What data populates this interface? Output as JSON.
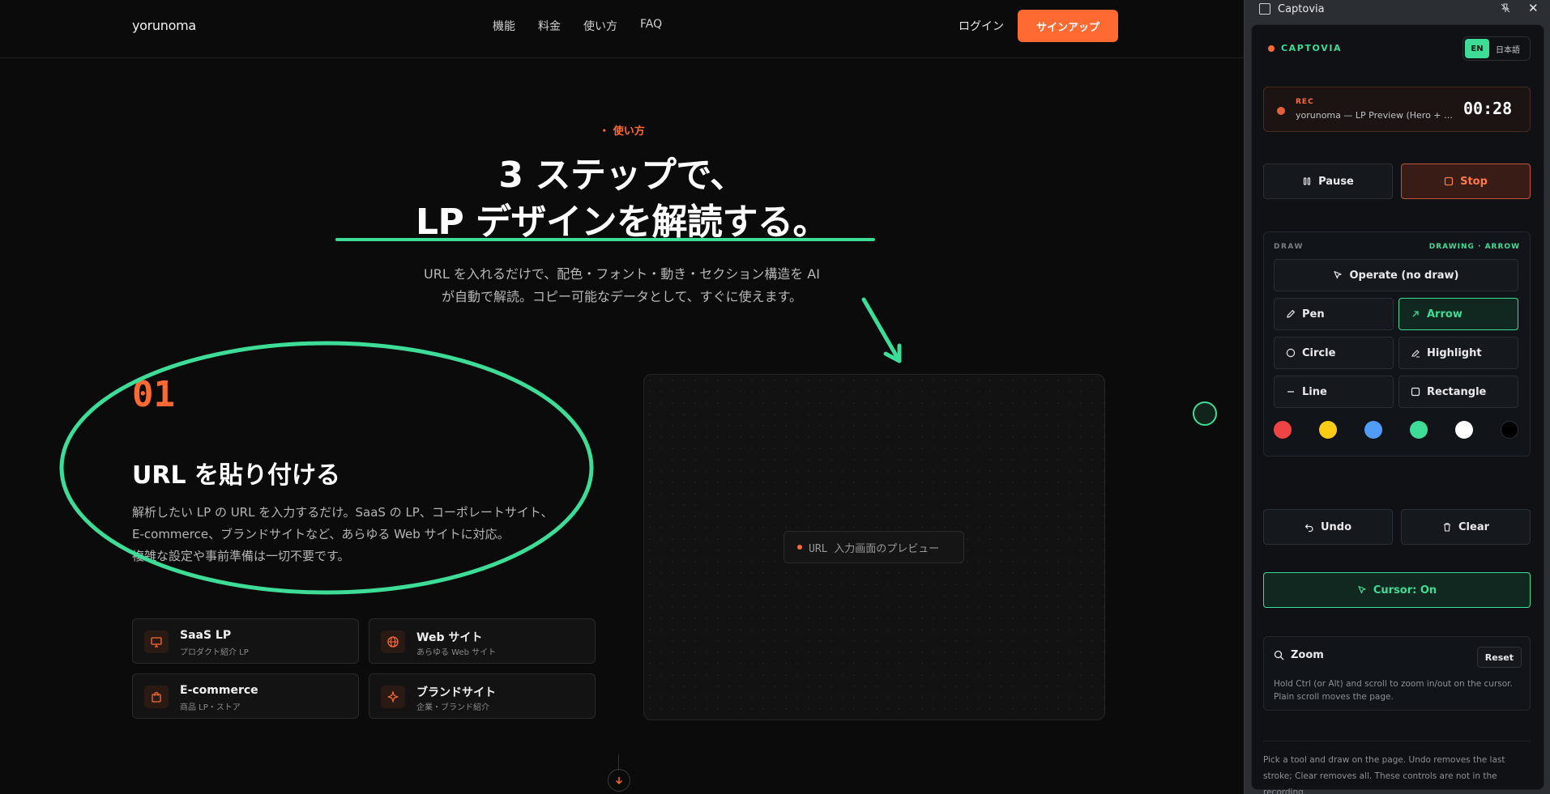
{
  "site": {
    "logo": "yorunoma",
    "nav": [
      "機能",
      "料金",
      "使い方",
      "FAQ"
    ],
    "login": "ログイン",
    "signup": "サインアップ"
  },
  "hero": {
    "eyebrow": "・ 使い方",
    "title_line1": "3 ステップで、",
    "title_line2": "LP デザインを解読する。",
    "sub_line1": "URL を入れるだけで、配色・フォント・動き・セクション構造を AI",
    "sub_line2": "が自動で解読。コピー可能なデータとして、すぐに使えます。"
  },
  "step": {
    "number": "01",
    "title": "URL を貼り付ける",
    "desc_line1": "解析したい LP の URL を入力するだけ。SaaS の LP、コーポレートサイト、",
    "desc_line2": "E-commerce、ブランドサイトなど、あらゆる Web サイトに対応。",
    "desc_line3": "複雑な設定や事前準備は一切不要です。"
  },
  "cards": [
    {
      "title": "SaaS LP",
      "sub": "プロダクト紹介 LP",
      "icon": "monitor-icon"
    },
    {
      "title": "Web サイト",
      "sub": "あらゆる Web サイト",
      "icon": "globe-icon"
    },
    {
      "title": "E-commerce",
      "sub": "商品 LP・ストア",
      "icon": "shopping-bag-icon"
    },
    {
      "title": "ブランドサイト",
      "sub": "企業・ブランド紹介",
      "icon": "sparkle-icon"
    }
  ],
  "preview": {
    "label": "URL 入力画面のプレビュー"
  },
  "panel": {
    "window_title": "Captovia",
    "brand": "CAPTOVIA",
    "lang": {
      "en": "EN",
      "ja": "日本語"
    },
    "rec": {
      "label": "REC",
      "name": "yorunoma — LP Preview (Hero + Ho...",
      "time": "00:28"
    },
    "pause": "Pause",
    "stop": "Stop",
    "draw": {
      "header": "DRAW",
      "status": "DRAWING · ARROW",
      "operate": "Operate (no draw)",
      "pen": "Pen",
      "arrow": "Arrow",
      "circle": "Circle",
      "highlight": "Highlight",
      "line": "Line",
      "rectangle": "Rectangle"
    },
    "colors": [
      "#ef4444",
      "#facc15",
      "#4f9cf9",
      "#3ddc97",
      "#ffffff",
      "#000000"
    ],
    "undo": "Undo",
    "clear": "Clear",
    "cursor": "Cursor: On",
    "zoom": {
      "title": "Zoom",
      "reset": "Reset",
      "help": "Hold Ctrl (or Alt) and scroll to zoom in/out on the cursor. Plain scroll moves the page."
    },
    "footer": "Pick a tool and draw on the page. Undo removes the last stroke; Clear removes all. These controls are not in the recording."
  },
  "colors": {
    "accent": "#ff6a33",
    "annotation": "#3ddc97"
  }
}
